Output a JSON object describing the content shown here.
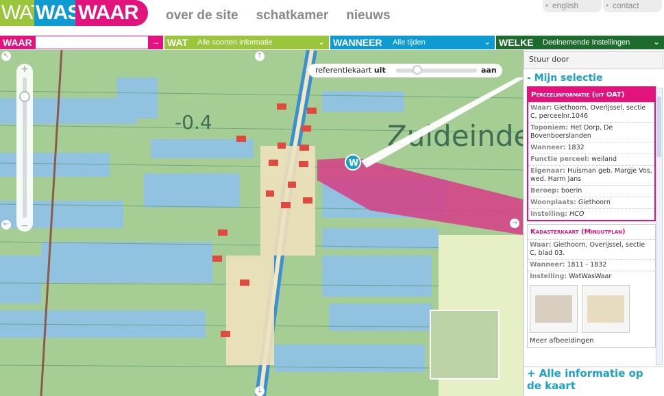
{
  "logo": {
    "part1": "WAT",
    "part2": "WAS",
    "part3": "WAAR"
  },
  "nav": {
    "items": [
      "over de site",
      "schatkamer",
      "nieuws"
    ]
  },
  "utility": {
    "english": "english",
    "contact": "contact"
  },
  "filters": {
    "waar": {
      "label": "WAAR",
      "value": ""
    },
    "wat": {
      "label": "WAT",
      "value": "Alle soorten informatie"
    },
    "wanneer": {
      "label": "WANNEER",
      "value": "Alle tijden"
    },
    "welke": {
      "label": "WELKE",
      "value": "Deelnemende Instellingen"
    }
  },
  "colors": {
    "pink": "#e2137d",
    "blue": "#0e9bd1",
    "green": "#9bc53d",
    "darkgreen": "#1e6b2e"
  },
  "map": {
    "labels": [
      "-0.4",
      "Zuideinde"
    ],
    "marker": "W",
    "reference": {
      "label": "referentiekaart",
      "off": "uit",
      "on": "aan"
    }
  },
  "panel": {
    "send": "Stuur door",
    "title": "- Mijn selectie",
    "card1": {
      "title": "Perceelinformatie (uit OAT)",
      "rows": [
        {
          "k": "Waar:",
          "v": "Giethoorn, Overijssel, sectie C, perceelnr.1046"
        },
        {
          "k": "Toponiem:",
          "v": "Het Dorp, De Bovenboerslanden"
        },
        {
          "k": "Wanneer:",
          "v": "1832"
        },
        {
          "k": "Functie perceel:",
          "v": "weiland"
        },
        {
          "k": "Eigenaar:",
          "v": "Huisman geb. Margje Vos, wed. Harm Jans"
        },
        {
          "k": "Beroep:",
          "v": "boerin"
        },
        {
          "k": "Woonplaats:",
          "v": "Giethoorn"
        },
        {
          "k": "Instelling:",
          "v": "HCO"
        }
      ]
    },
    "card2": {
      "title": "Kadasterkaart (Minuutplan)",
      "rows": [
        {
          "k": "Waar:",
          "v": "Giethoorn, Overijssel, sectie C, blad 03."
        },
        {
          "k": "Wanneer:",
          "v": "1811 - 1832"
        },
        {
          "k": "Instelling:",
          "v": "WatWasWaar"
        }
      ],
      "more": "Meer afbeeldingen"
    },
    "all": "+ Alle informatie op de kaart"
  }
}
